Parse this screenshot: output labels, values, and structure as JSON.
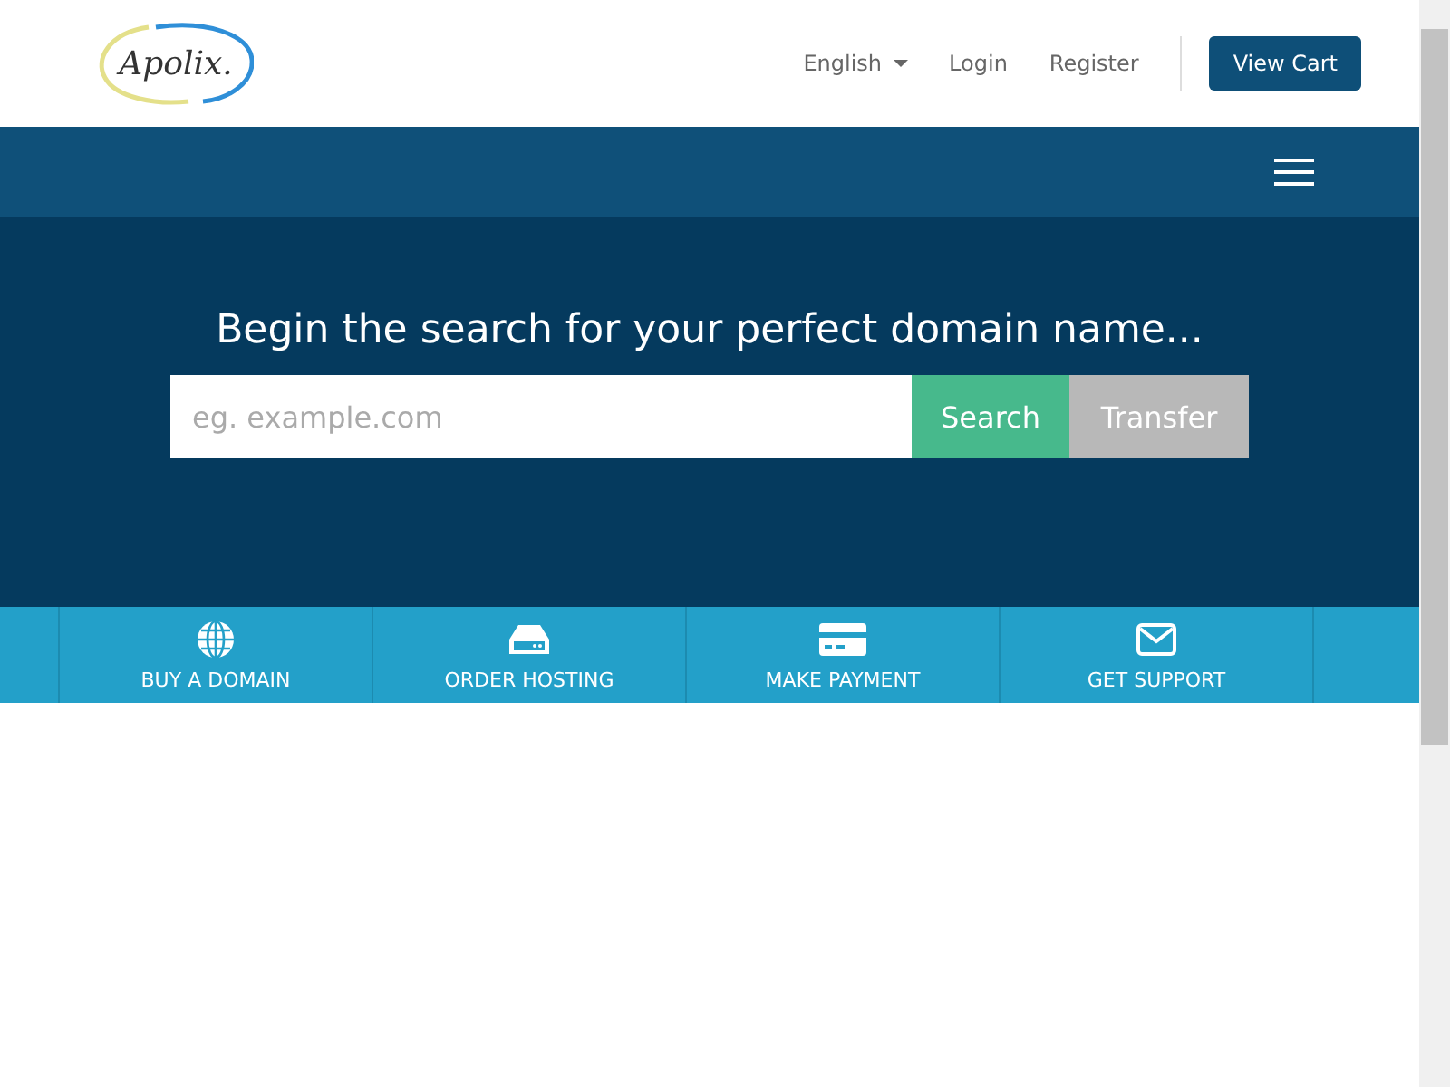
{
  "header": {
    "logo": "Apolix.",
    "nav": [
      {
        "label": "English",
        "kind": "dropdown"
      },
      {
        "label": "Login",
        "kind": "link"
      },
      {
        "label": "Register",
        "kind": "link"
      }
    ],
    "cart_button": "View Cart"
  },
  "hero": {
    "title": "Begin the search for your perfect domain name...",
    "search": {
      "placeholder": "eg. example.com"
    },
    "buttons": [
      {
        "label": "Search",
        "kind": "primary"
      },
      {
        "label": "Transfer",
        "kind": "secondary"
      }
    ]
  },
  "shortcuts": [
    {
      "label": "BUY A DOMAIN",
      "kind": "globe"
    },
    {
      "label": "ORDER HOSTING",
      "kind": "server"
    },
    {
      "label": "MAKE PAYMENT",
      "kind": "card"
    },
    {
      "label": "GET SUPPORT",
      "kind": "envelope"
    }
  ]
}
